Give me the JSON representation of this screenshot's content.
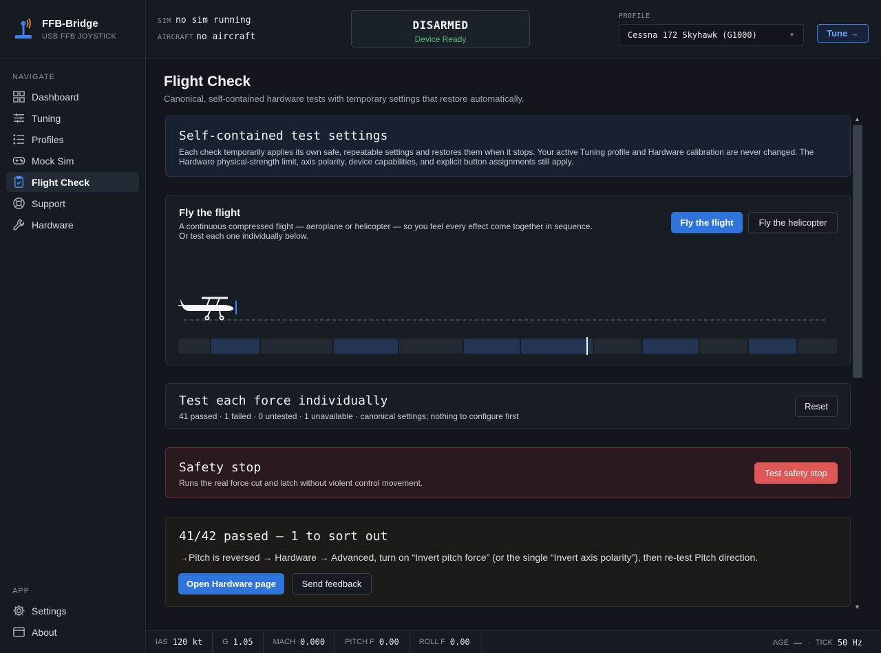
{
  "brand": {
    "title": "FFB-Bridge",
    "subtitle": "USB FFB JOYSTICK"
  },
  "nav": {
    "heading": "NAVIGATE",
    "items": [
      {
        "label": "Dashboard",
        "icon": "dashboard-icon"
      },
      {
        "label": "Tuning",
        "icon": "sliders-icon"
      },
      {
        "label": "Profiles",
        "icon": "list-icon"
      },
      {
        "label": "Mock Sim",
        "icon": "gamepad-icon"
      },
      {
        "label": "Flight Check",
        "icon": "clipboard-check-icon",
        "active": true
      },
      {
        "label": "Support",
        "icon": "lifebuoy-icon"
      },
      {
        "label": "Hardware",
        "icon": "wrench-icon"
      }
    ]
  },
  "app_nav": {
    "heading": "APP",
    "items": [
      {
        "label": "Settings",
        "icon": "gear-icon"
      },
      {
        "label": "About",
        "icon": "window-icon"
      }
    ]
  },
  "topbar": {
    "sim_key": "SIM",
    "sim_value": "no sim running",
    "aircraft_key": "AIRCRAFT",
    "aircraft_value": "no aircraft",
    "status": "DISARMED",
    "status_sub": "Device Ready",
    "profile_label": "PROFILE",
    "profile_value": "Cessna 172 Skyhawk (G1000)",
    "tune_label": "Tune →"
  },
  "page": {
    "title": "Flight Check",
    "subtitle": "Canonical, self-contained hardware tests with temporary settings that restore automatically."
  },
  "settings_card": {
    "title": "Self-contained test settings",
    "text": "Each check temporarily applies its own safe, repeatable settings and restores them when it stops. Your active Tuning profile and Hardware calibration are never changed. The Hardware physical-strength limit, axis polarity, device capabilities, and explicit button assignments still apply."
  },
  "fly_card": {
    "title": "Fly the flight",
    "line1": "A continuous compressed flight — aeroplane or helicopter — so you feel every effect come together in sequence.",
    "line2": "Or test each one individually below.",
    "btn_flight": "Fly the flight",
    "btn_heli": "Fly the helicopter"
  },
  "test_card": {
    "title": "Test each force individually",
    "summary": "41 passed · 1 failed · 0 untested · 1 unavailable · canonical settings; nothing to configure first",
    "reset": "Reset"
  },
  "safety_card": {
    "title": "Safety stop",
    "text": "Runs the real force cut and latch without violent control movement.",
    "button": "Test safety stop"
  },
  "summary_card": {
    "title": "41/42 passed — 1 to sort out",
    "arrow": "→",
    "text": "Pitch is reversed → Hardware → Advanced, turn on “Invert pitch force” (or the single “Invert axis polarity”), then re-test Pitch direction.",
    "btn_hardware": "Open Hardware page",
    "btn_feedback": "Send feedback"
  },
  "telemetry": [
    {
      "key": "IAS",
      "value": "120 kt"
    },
    {
      "key": "G",
      "value": "1.05"
    },
    {
      "key": "MACH",
      "value": "0.000"
    },
    {
      "key": "PITCH F",
      "value": "0.00"
    },
    {
      "key": "ROLL F",
      "value": "0.00"
    }
  ],
  "telemetry_right": {
    "age_key": "AGE",
    "age_value": "—",
    "dot": "·",
    "tick_key": "TICK",
    "tick_value": "50 Hz"
  },
  "colors": {
    "accent": "#2f74db",
    "ok": "#4ec079",
    "danger": "#e05757",
    "warn_arrow": "#e08a3c"
  }
}
